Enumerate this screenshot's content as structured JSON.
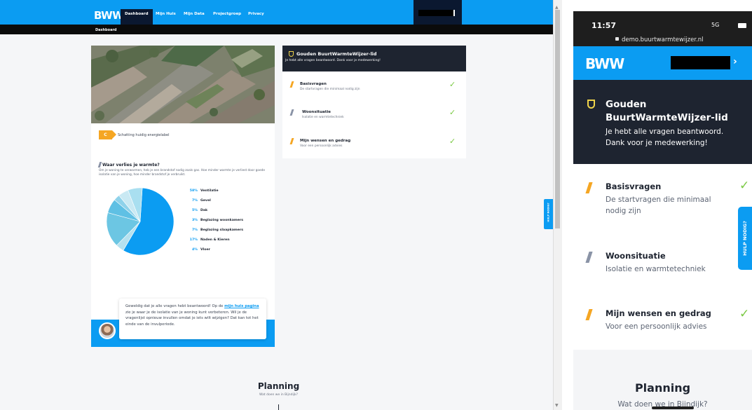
{
  "colors": {
    "brand_blue": "#0b9cf2",
    "dark_navy": "#1e2430",
    "check_green": "#7ac943",
    "energy_orange": "#f5a623",
    "slash_grey": "#8a93a6"
  },
  "desktop": {
    "logo": "BWW",
    "nav": [
      {
        "label": "Dashboard",
        "active": true
      },
      {
        "label": "Mijn Huis",
        "active": false
      },
      {
        "label": "Mijn Data",
        "active": false
      },
      {
        "label": "Projectgroep",
        "active": false
      },
      {
        "label": "Privacy",
        "active": false
      }
    ],
    "breadcrumb": "Dashboard",
    "energy_label": {
      "grade": "C",
      "text": "Schatting huidig energielabel"
    },
    "heat_loss": {
      "title": "Waar verlies je warmte?",
      "description": "Om je woning te verwarmen, heb je een brandstof nodig zoals gas. Hoe minder warmte je verliest door goede isolatie van je woning, hoe minder brandstof je verbruikt."
    },
    "message": {
      "before": "Geweldig dat je alle vragen hebt beantwoord! Op de ",
      "link": "mijn huis pagina",
      "after": " zie je waar je de isolatie van je woning kunt verbeteren. Wil je de vragenlijst opnieuw invullen omdat je iets wilt wijzigen? Dat kan tot het einde van de invulperiode."
    },
    "badge": {
      "title": "Gouden BuurtWarmteWijzer-lid",
      "subtitle": "Je hebt alle vragen beantwoord. Dank voor je medewerking!"
    },
    "steps": [
      {
        "title": "Basisvragen",
        "desc": "De startvragen die minimaal nodig zijn",
        "color": "#f5a623"
      },
      {
        "title": "Woonsituatie",
        "desc": "Isolatie en warmtetechniek",
        "color": "#8a93a6"
      },
      {
        "title": "Mijn wensen en gedrag",
        "desc": "Voor een persoonlijk advies",
        "color": "#f5a623"
      }
    ],
    "planning": {
      "title": "Planning",
      "subtitle": "Wat doen we in Bijndijk?"
    },
    "help_label": "HULP NODIG?",
    "scroll": {
      "up": "▲",
      "down": "▼"
    }
  },
  "chart_data": {
    "type": "pie",
    "categories": [
      "Ventilatie",
      "Gevel",
      "Dak",
      "Beglazing woonkamers",
      "Beglazing slaapkamers",
      "Naden & Kieren",
      "Vloer"
    ],
    "values": [
      58,
      7,
      5,
      3,
      7,
      17,
      4
    ],
    "labels": [
      "58%",
      "7%",
      "5%",
      "3%",
      "7%",
      "17%",
      "4%"
    ],
    "colors": [
      "#0b9cf2",
      "#a9dff0",
      "#c9e9f3",
      "#8fd2ea",
      "#5fc0e4",
      "#6cc6e3",
      "#b5e1ef"
    ]
  },
  "phone": {
    "time": "11:57",
    "signal": "5G",
    "url": "demo.buurtwarmtewijzer.nl",
    "logo": "BWW",
    "chevron": "›",
    "badge": {
      "title": "Gouden BuurtWarmteWijzer-lid",
      "subtitle": "Je hebt alle vragen beantwoord. Dank voor je medewerking!"
    },
    "steps": [
      {
        "title": "Basisvragen",
        "desc": "De startvragen die minimaal nodig zijn",
        "color": "#f5a623"
      },
      {
        "title": "Woonsituatie",
        "desc": "Isolatie en warmtetechniek",
        "color": "#8a93a6"
      },
      {
        "title": "Mijn wensen en gedrag",
        "desc": "Voor een persoonlijk advies",
        "color": "#f5a623"
      }
    ],
    "help_label": "HULP NODIG?",
    "planning": {
      "title": "Planning",
      "subtitle": "Wat doen we in Bijndijk?"
    }
  }
}
